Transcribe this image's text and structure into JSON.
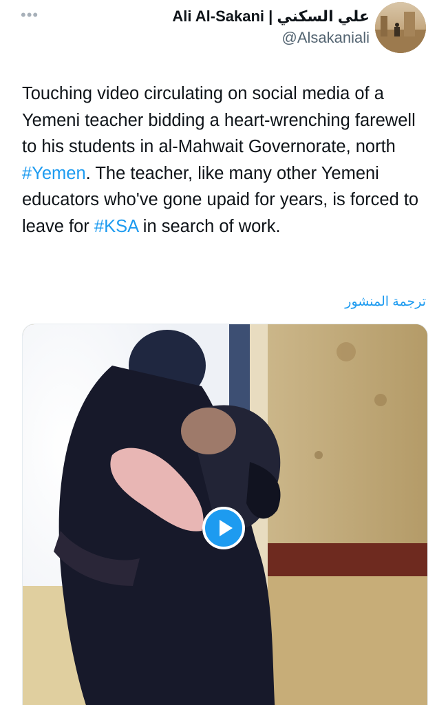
{
  "tweet": {
    "author": {
      "display_name": "Ali Al-Sakani | علي السكني",
      "handle": "@Alsakaniali"
    },
    "more_icon": "ellipsis-icon",
    "text_parts": {
      "p1": "Touching video circulating on social media of a Yemeni teacher bidding a heart-wrenching farewell to his students in al-Mahwait Governorate, north ",
      "hashtag1": "#Yemen",
      "p2": ". The teacher, like many other Yemeni educators who've gone upaid for years, is forced to leave for ",
      "hashtag2": "#KSA",
      "p3": " in search of work."
    },
    "translate_label": "ترجمة المنشور",
    "media": {
      "type": "video",
      "play_icon": "play-icon"
    }
  },
  "colors": {
    "accent": "#1d9bf0",
    "text": "#0f1419",
    "secondary_text": "#536471"
  }
}
